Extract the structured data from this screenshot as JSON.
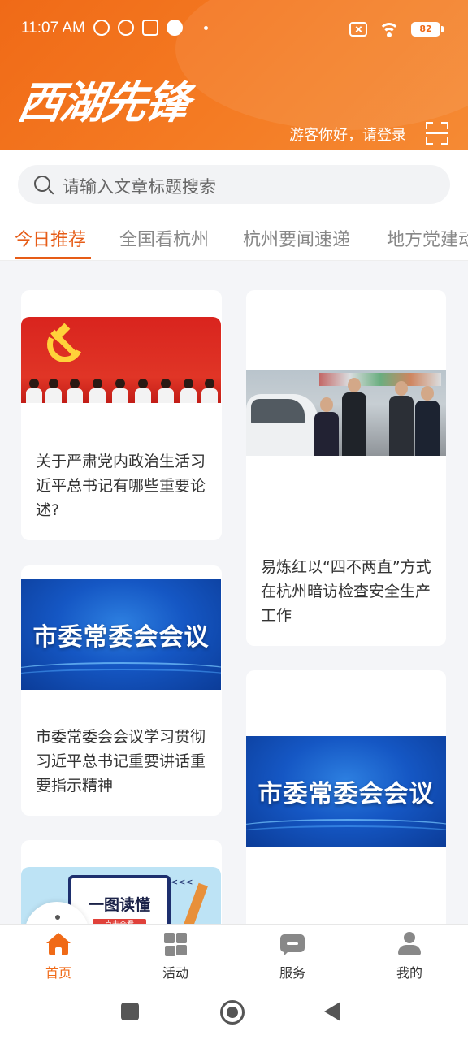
{
  "status_bar": {
    "time": "11:07 AM",
    "battery": "82"
  },
  "header": {
    "logo_text": "西湖先锋",
    "login_text": "游客你好，请登录"
  },
  "search": {
    "placeholder": "请输入文章标题搜索"
  },
  "tabs": [
    {
      "label": "今日推荐",
      "active": true
    },
    {
      "label": "全国看杭州",
      "active": false
    },
    {
      "label": "杭州要闻速递",
      "active": false
    },
    {
      "label": "地方党建动态",
      "active": false
    }
  ],
  "articles": [
    {
      "title": "关于严肃党内政治生活习近平总书记有哪些重要论述?"
    },
    {
      "title": "易炼红以“四不两直”方式在杭州暗访检查安全生产工作"
    },
    {
      "title": "市委常委会会议学习贯彻习近平总书记重要讲话重要指示精神",
      "image_text": "市委常委会会议"
    },
    {
      "image_text": "市委常委会会议"
    },
    {
      "image_text": "一图读懂",
      "image_button": "点击查看",
      "image_arrows": "<<<"
    }
  ],
  "bottom_nav": [
    {
      "label": "首页",
      "icon": "home-icon",
      "active": true
    },
    {
      "label": "活动",
      "icon": "activity-grid-icon",
      "active": false
    },
    {
      "label": "服务",
      "icon": "service-chat-icon",
      "active": false
    },
    {
      "label": "我的",
      "icon": "profile-icon",
      "active": false
    }
  ],
  "colors": {
    "accent": "#f06a17",
    "tab_active": "#e65c17",
    "background": "#f4f5f8"
  }
}
